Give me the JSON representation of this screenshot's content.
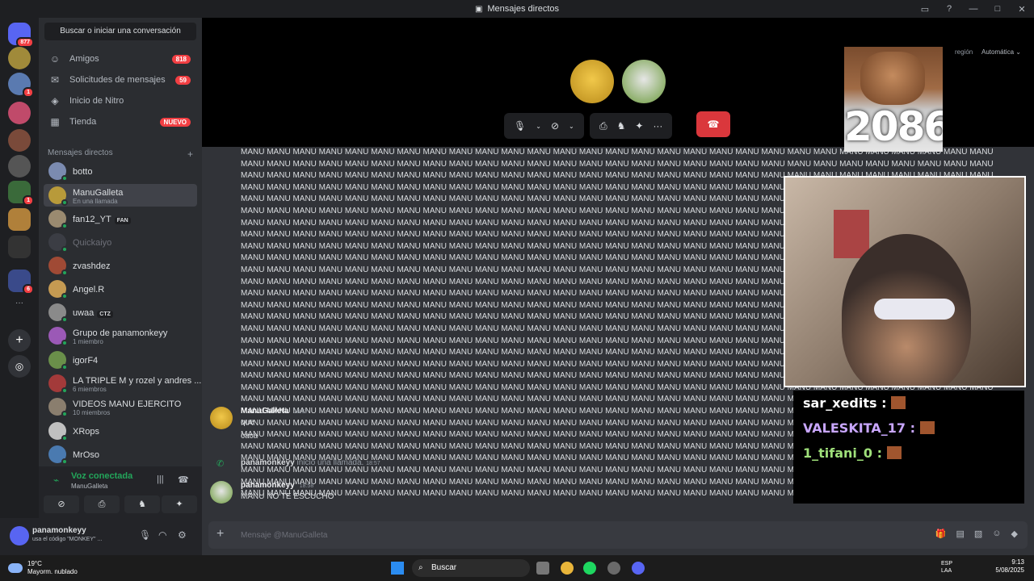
{
  "window": {
    "title": "Mensajes directos"
  },
  "guilds": {
    "home_badge": "877",
    "badge_2": "1",
    "badge_3": "1",
    "badge_4": "6"
  },
  "sidebar": {
    "search_label": "Buscar o iniciar una conversación",
    "nav": [
      {
        "label": "Amigos",
        "badge": "818"
      },
      {
        "label": "Solicitudes de mensajes",
        "badge": "59"
      },
      {
        "label": "Inicio de Nitro",
        "badge": ""
      },
      {
        "label": "Tienda",
        "badge": "NUEVO"
      }
    ],
    "dm_header": "Mensajes directos",
    "dms": [
      {
        "name": "botto",
        "sub": "",
        "tag": "",
        "color": "#7b8bb0"
      },
      {
        "name": "ManuGalleta",
        "sub": "En una llamada",
        "tag": "",
        "color": "#b89a3a"
      },
      {
        "name": "fan12_YT",
        "sub": "",
        "tag": "FAN",
        "color": "#9a8a70"
      },
      {
        "name": "Quickaiyo",
        "sub": "",
        "tag": "",
        "color": "#3b3d44"
      },
      {
        "name": "zvashdez",
        "sub": "",
        "tag": "",
        "color": "#a04a35"
      },
      {
        "name": "Angel.R",
        "sub": "",
        "tag": "",
        "color": "#c59a52"
      },
      {
        "name": "uwaa",
        "sub": "",
        "tag": "CTZ",
        "color": "#8a8a8a"
      },
      {
        "name": "Grupo de panamonkeyy",
        "sub": "1 miembro",
        "tag": "",
        "color": "#9b59b6"
      },
      {
        "name": "igorF4",
        "sub": "",
        "tag": "",
        "color": "#6a8f4a"
      },
      {
        "name": "LA TRIPLE M y rozel y andres ...",
        "sub": "6 miembros",
        "tag": "",
        "color": "#a33a3a"
      },
      {
        "name": "VIDEOS MANU EJERCITO",
        "sub": "10 miembros",
        "tag": "",
        "color": "#8a7e6e"
      },
      {
        "name": "XRops",
        "sub": "",
        "tag": "",
        "color": "#c0c0c0"
      },
      {
        "name": "MrOso",
        "sub": "",
        "tag": "",
        "color": "#4a7ab0"
      }
    ]
  },
  "voice": {
    "status": "Voz conectada",
    "channel": "ManuGalleta"
  },
  "user": {
    "name": "panamonkeyy",
    "status": "usa el código \"MONKEY\" ..."
  },
  "call": {
    "region_label": "región",
    "region_value": "Automática"
  },
  "chat": {
    "spam_text": "MANU MANU MANU MANU MANU MANU MANU MANU MANU MANU MANU MANU MANU MANU MANU MANU MANU MANU MANU MANU MANU MANU MANU MANU MANU MANU MANU MANU MANU MANU MANU MANU MANU MANU MANU MANU MANU MANU MANU MANU MANU MANU MANU MANU MANU MANU MANU MANU MANU MANU MANU MANU MANU MANU MANU MANU MANU MANU MANU MANU MANU MANU MANU MANU MANU MANU MANU MANU MANU MANU MANU MANU MANU MANU MANU MANU MANU MANU MANU MANU MANU MANU MANU MANU MANU MANU MANU MANU MANU MANU MANU MANU MANU MANU MANU MANU MANU MANU MANU MANU MANU MANU MANU MANU MANU MANU MANU MANU MANU MANU MANU MANU MANU MANU MANU MANU MANU MANU MANU MANU MANU MANU MANU MANU MANU MANU MANU MANU MANU MANU MANU MANU MANU MANU MANU MANU MANU MANU MANU MANU MANU MANU MANU MANU MANU MANU MANU MANU MANU MANU MANU MANU MANU MANU MANU MANU MANU MANU MANU MANU MANU MANU MANU MANU MANU MANU MANU MANU MANU MANU MANU MANU MANU MANU MANU MANU MANU MANU MANU MANU MANU MANU MANU MANU MANU MANU MANU MANU MANU MANU MANU MANU MANU MANU MANU MANU MANU MANU MANU MANU MANU MANU MANU MANU MANU MANU MANU MANU MANU MANU MANU MANU MANU MANU MANU MANU MANU MANU MANU MANU MANU MANU MANU MANU MANU MANU MANU MANU MANU MANU MANU MANU MANU MANU MANU MANU MANU MANU MANU MANU MANU MANU MANU MANU MANU MANU MANU MANU MANU MANU MANU MANU MANU MANU MANU MANU MANU MANU MANU MANU MANU MANU MANU MANU MANU MANU MANU MANU MANU MANU MANU MANU MANU MANU MANU MANU MANU MANU MANU MANU MANU MANU MANU MANU MANU MANU MANU MANU MANU MANU MANU MANU MANU MANU MANU MANU MANU MANU MANU MANU MANU MANU MANU MANU MANU MANU MANU MANU MANU MANU MANU MANU MANU MANU MANU MANU MANU MANU MANU MANU MANU MANU MANU MANU MANU MANU MANU MANU MANU MANU MANU MANU MANU MANU MANU MANU MANU MANU MANU MANU MANU MANU MANU MANU MANU MANU MANU MANU MANU MANU MANU MANU MANU MANU MANU MANU MANU MANU MANU MANU MANU MANU MANU MANU MANU MANU MANU MANU MANU MANU MANU MANU MANU MANU MANU MANU MANU MANU MANU MANU MANU MANU MANU MANU MANU MANU MANU MANU MANU MANU MANU MANU MANU MANU MANU MANU MANU MANU MANU MANU MANU MANU MANU MANU MANU MANU MANU MANU MANU MANU MANU MANU MANU MANU MANU MANU MANU MANU MANU MANU MANU MANU MANU MANU MANU MANU MANU MANU MANU MANU MANU MANU MANU MANU MANU MANU MANU MANU MANU MANU MANU MANU MANU MANU MANU MANU MANU MANU MANU MANU MANU MANU MANU MANU MANU MANU MANU MANU MANU MANU MANU MANU MANU MANU MANU MANU MANU MANU MANU MANU MANU MANU MANU MANU MANU MANU MANU MANU MANU MANU MANU MANU MANU MANU MANU MANU MANU MANU MANU MANU MANU MANU MANU MANU MANU MANU MANU MANU MANU MANU MANU MANU MANU MANU MANU MANU MANU MANU MANU MANU MANU MANU MANU MANU MANU MANU MANU MANU MANU MANU MANU MANU MANU MANU MANU MANU MANU MANU MANU MANU MANU MANU MANU MANU MANU MANU MANU MANU MANU MANU MANU MANU MANU MANU MANU MANU MANU MANU MANU MANU MANU MANU MANU MANU MANU MANU MANU MANU MANU MANU MANU MANU MANU MANU MANU MANU MANU MANU MANU MANU MANU MANU MANU MANU MANU MANU MANU MANU MANU MANU MANU MANU MANU MANU MANU MANU MANU MANU MANU MANU MANU MANU MANU MANU MANU MANU MANU MANU MANU MANU MANU MANU MANU MANU MANU MANU MANU MANU MANU MANU MANU MANU MANU MANU MANU MANU MANU MANU MANU MANU MANU MANU MANU MANU MANU MANU MANU MANU MANU MANU MANU MANU MANU MANU MANU MANU MANU MANU MANU MANU MANU MANU MANU MANU MANU MANU MANU MANU MANU MANU MANU MANU MANU MANU MANU MANU MANU MANU MANU MANU MANU MANU MANU MANU MANU MANU MANU MANU MANU MANU MANU MANU MANU MANU MANU MANU MANU MANU MANU MANU MANU MANU MANU MANU MANU MANU MANU MANU MANU MANU MANU MANU MANU MANU MANU MANU MANU MANU MANU MANU MANU MANU MANU MANU MANU MANU MANU MANU MANU MANU MANU MANU MANU MANU MANU MANU MANU MANU MANU MANU MANU MANU MANU MANU MANU MANU MANU MANU MANU MANU MANU MANU MANU MANU MANU MANU MANU MANU MANU MANU MANU MANU MANU MANU MANU MANU MANU MANU MANU MANU MANU MANU MANU MANU MANU MANU MANU MANU MANU MANU MANU MANU MANU MANU MANU MANU MANU MANU MANU MANU MANU MANU MANU MANU MANU MANU MANU MANU MANU MANU MANU MANU MANU MANU MANU MANU MANU MANU MANU MANU MANU MANU MANU MANU MANU MANU MANU MANU MANU MANU MANU MANU MANU MANU MANU MANU MANU MANU MANU MANU MANU MANU MANU MANU MANU MANU MANU MANU MANU MANU MANU MANU MANU MANU MANU MANU MANU MANU MANU MANU MANU MANU MANU MANU MANU MANU MANU MANU MANU MANU MANU MANU MANU MANU MANU MANU MANU MANU MANU MANU MANU MANU MANU MANU MANU MANU MANU MANU MANU MANU MANU MANU MANU MANU MANU",
    "msg1": {
      "author": "ManuGalleta",
      "time": "18:57",
      "line1": "que",
      "line2": "caca"
    },
    "sys": {
      "author": "panamonkeyy",
      "text": "inició una llamada.",
      "time": "18:57"
    },
    "msg2": {
      "author": "panamonkeyy",
      "time": "18:58",
      "line1": "MANU NO TE ESCUCHO"
    },
    "placeholder": "Mensaje @ManuGalleta"
  },
  "overlay": {
    "meme_number": "2086",
    "chat": [
      "sar_xedits :",
      "VALESKITA_17 :",
      "1_tifani_0 :"
    ]
  },
  "taskbar": {
    "temp": "19°C",
    "weather": "Mayorm. nublado",
    "search": "Buscar",
    "lang1": "ESP",
    "lang2": "LAA",
    "time": "9:13",
    "date": "5/08/2025"
  }
}
